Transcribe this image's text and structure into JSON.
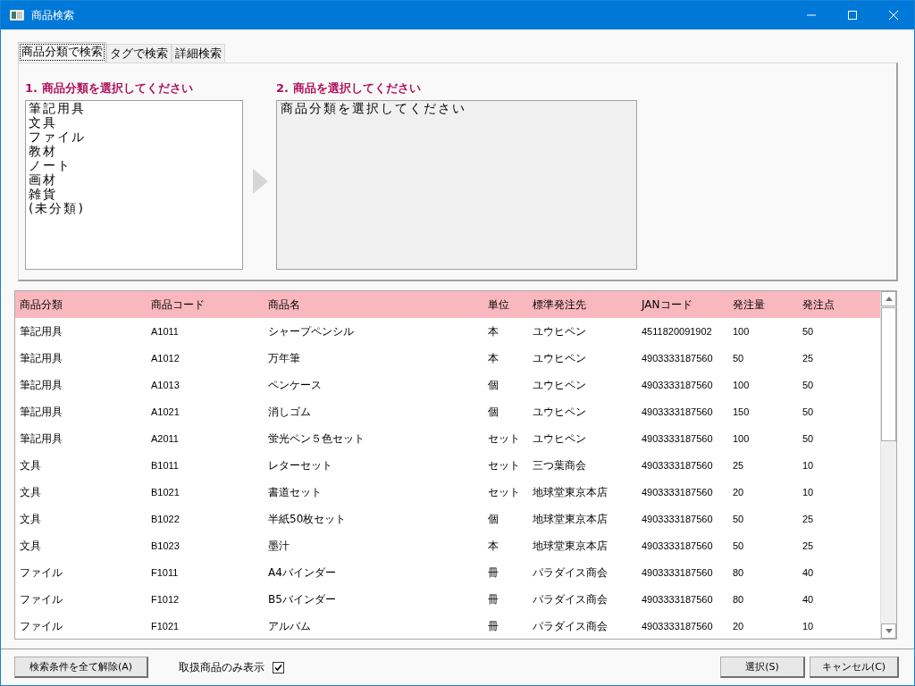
{
  "window": {
    "title": "商品検索"
  },
  "tabs": [
    {
      "label": "商品分類で検索",
      "selected": true
    },
    {
      "label": "タグで検索",
      "selected": false
    },
    {
      "label": "詳細検索",
      "selected": false
    }
  ],
  "category_panel": {
    "heading": "1. 商品分類を選択してください",
    "items": [
      "筆記用具",
      "文具",
      "ファイル",
      "教材",
      "ノート",
      "画材",
      "雑貨",
      "(未分類)"
    ]
  },
  "product_panel": {
    "heading": "2. 商品を選択してください",
    "message": "商品分類を選択してください"
  },
  "table": {
    "columns": [
      "商品分類",
      "商品コード",
      "商品名",
      "単位",
      "標準発注先",
      "JANコード",
      "発注量",
      "発注点"
    ],
    "rows": [
      [
        "筆記用具",
        "A1011",
        "シャープペンシル",
        "本",
        "ユウヒペン",
        "4511820091902",
        "100",
        "50"
      ],
      [
        "筆記用具",
        "A1012",
        "万年筆",
        "本",
        "ユウヒペン",
        "4903333187560",
        "50",
        "25"
      ],
      [
        "筆記用具",
        "A1013",
        "ペンケース",
        "個",
        "ユウヒペン",
        "4903333187560",
        "100",
        "50"
      ],
      [
        "筆記用具",
        "A1021",
        "消しゴム",
        "個",
        "ユウヒペン",
        "4903333187560",
        "150",
        "50"
      ],
      [
        "筆記用具",
        "A2011",
        "蛍光ペン５色セット",
        "セット",
        "ユウヒペン",
        "4903333187560",
        "100",
        "50"
      ],
      [
        "文具",
        "B1011",
        "レターセット",
        "セット",
        "三つ葉商会",
        "4903333187560",
        "25",
        "10"
      ],
      [
        "文具",
        "B1021",
        "書道セット",
        "セット",
        "地球堂東京本店",
        "4903333187560",
        "20",
        "10"
      ],
      [
        "文具",
        "B1022",
        "半紙50枚セット",
        "個",
        "地球堂東京本店",
        "4903333187560",
        "50",
        "25"
      ],
      [
        "文具",
        "B1023",
        "墨汁",
        "本",
        "地球堂東京本店",
        "4903333187560",
        "50",
        "25"
      ],
      [
        "ファイル",
        "F1011",
        "A4バインダー",
        "冊",
        "パラダイス商会",
        "4903333187560",
        "80",
        "40"
      ],
      [
        "ファイル",
        "F1012",
        "B5バインダー",
        "冊",
        "パラダイス商会",
        "4903333187560",
        "80",
        "40"
      ],
      [
        "ファイル",
        "F1021",
        "アルバム",
        "冊",
        "パラダイス商会",
        "4903333187560",
        "20",
        "10"
      ]
    ]
  },
  "footer": {
    "clear_button": "検索条件を全て解除(A)",
    "filter_checkbox": {
      "label": "取扱商品のみ表示",
      "checked": true
    },
    "buttons": [
      "選択(S)",
      "キャンセル(C)"
    ]
  }
}
